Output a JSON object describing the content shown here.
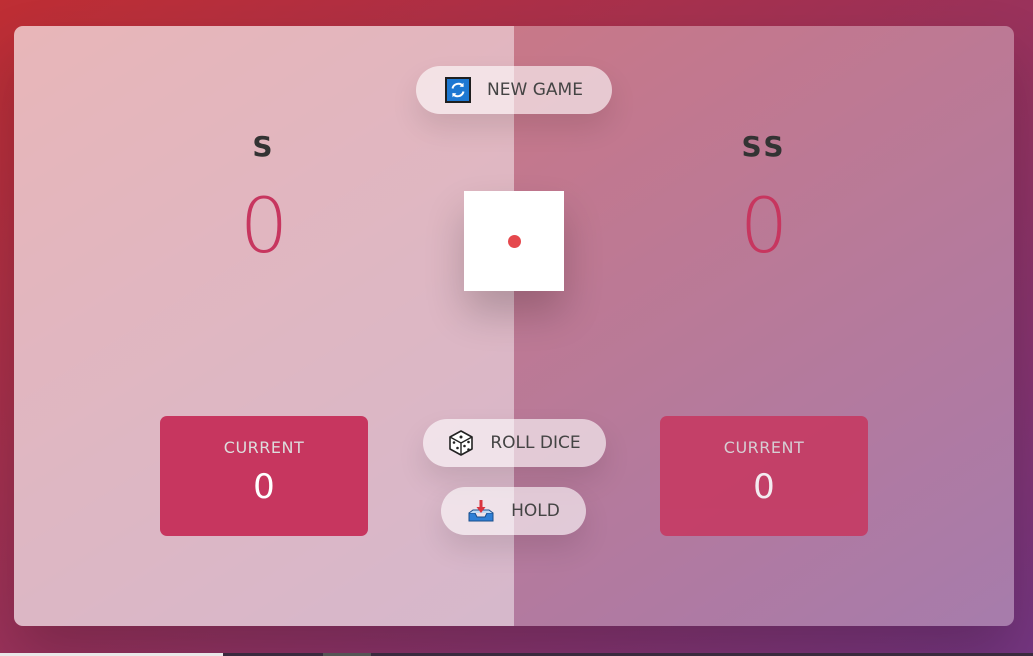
{
  "players": [
    {
      "name": "s",
      "score": "0",
      "current_label": "Current",
      "current_score": "0"
    },
    {
      "name": "ss",
      "score": "0",
      "current_label": "Current",
      "current_score": "0"
    }
  ],
  "buttons": {
    "new_game": "New game",
    "roll_dice": "Roll dice",
    "hold": "Hold"
  },
  "dice": {
    "value": 1,
    "pip_color": "#e5484d"
  },
  "icons": {
    "new_game": "refresh-icon",
    "roll_dice": "dice-icon",
    "hold": "inbox-tray-icon"
  },
  "colors": {
    "accent": "#c7365f",
    "gradient_start": "#bf2e34",
    "gradient_end": "#753682"
  }
}
